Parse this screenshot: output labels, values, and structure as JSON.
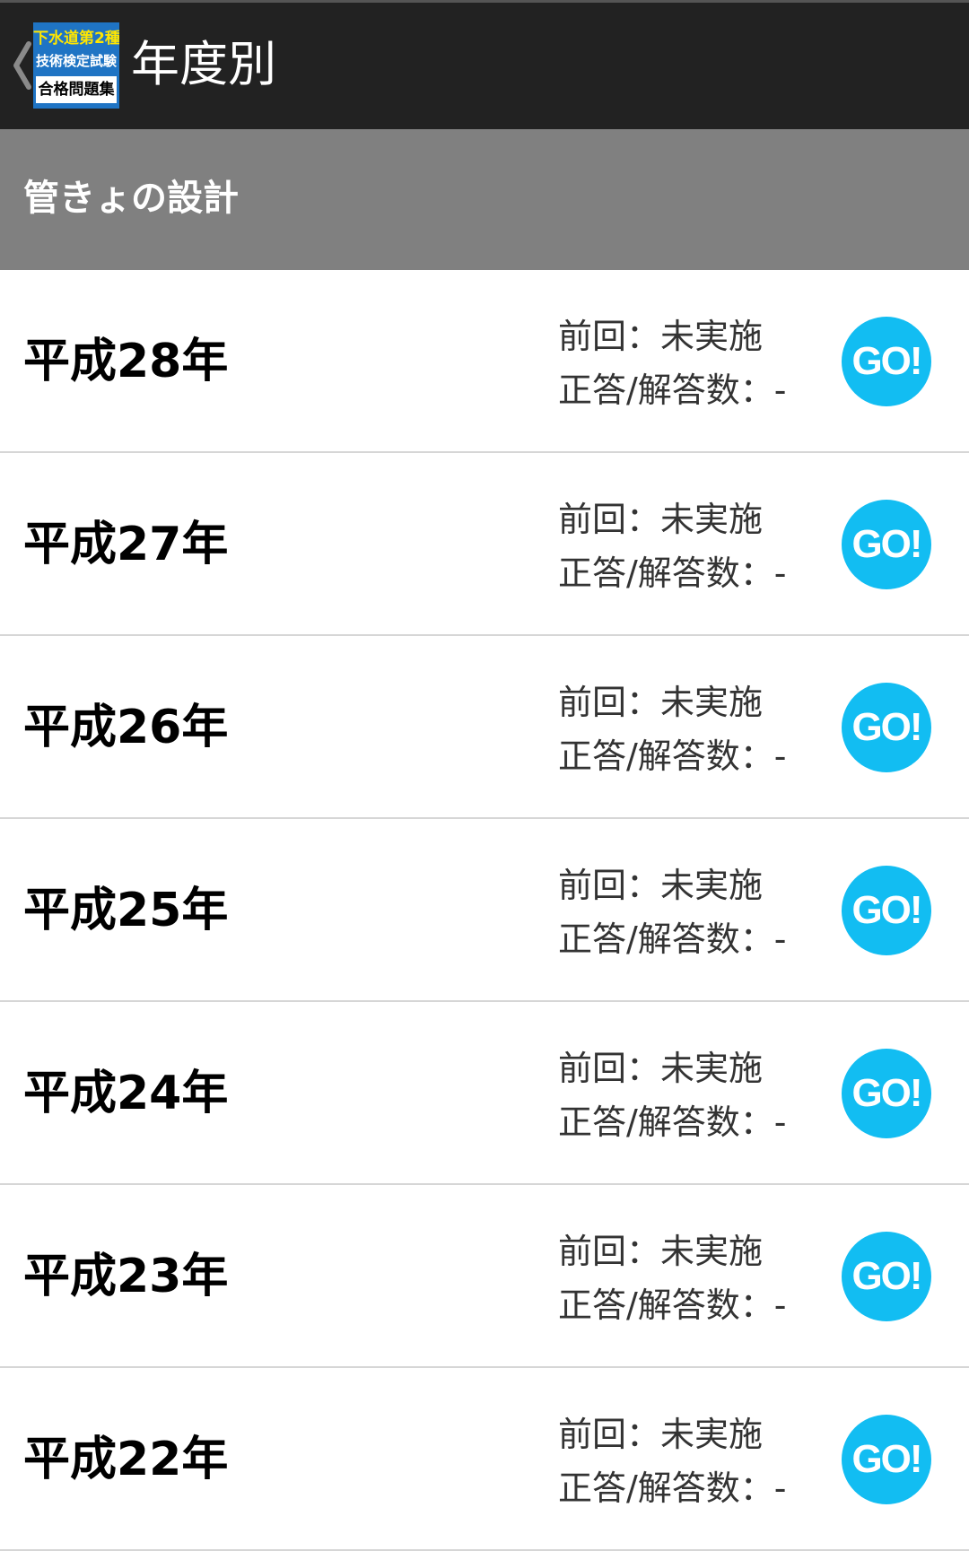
{
  "app_bar": {
    "logo": {
      "line1": "下水道第2種",
      "line2": "技術検定試験",
      "line3": "合格問題集"
    },
    "title": "年度別"
  },
  "section": {
    "title": "管きょの設計"
  },
  "years": [
    {
      "label": "平成28年",
      "previous": "前回：未実施",
      "score": "正答/解答数：-",
      "button": "GO!"
    },
    {
      "label": "平成27年",
      "previous": "前回：未実施",
      "score": "正答/解答数：-",
      "button": "GO!"
    },
    {
      "label": "平成26年",
      "previous": "前回：未実施",
      "score": "正答/解答数：-",
      "button": "GO!"
    },
    {
      "label": "平成25年",
      "previous": "前回：未実施",
      "score": "正答/解答数：-",
      "button": "GO!"
    },
    {
      "label": "平成24年",
      "previous": "前回：未実施",
      "score": "正答/解答数：-",
      "button": "GO!"
    },
    {
      "label": "平成23年",
      "previous": "前回：未実施",
      "score": "正答/解答数：-",
      "button": "GO!"
    },
    {
      "label": "平成22年",
      "previous": "前回：未実施",
      "score": "正答/解答数：-",
      "button": "GO!"
    }
  ],
  "colors": {
    "app_bar": "#222222",
    "section_header": "#808080",
    "go_button": "#12bdf2",
    "logo_background": "#1f74c4",
    "logo_highlight": "#ffe600"
  }
}
